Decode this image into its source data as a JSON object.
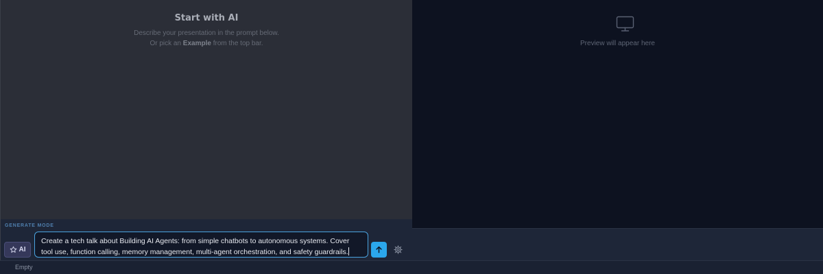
{
  "editor": {
    "empty_title": "Start with AI",
    "desc_line1": "Describe your presentation in the prompt below.",
    "desc_line2_prefix": "Or pick an ",
    "desc_line2_bold": "Example",
    "desc_line2_suffix": " from the top bar."
  },
  "preview": {
    "placeholder": "Preview will appear here",
    "icon": "monitor-icon"
  },
  "prompt": {
    "mode_label": "GENERATE MODE",
    "ai_button_label": "AI",
    "ai_icon": "star-icon",
    "value": "Create a tech talk about Building AI Agents: from simple chatbots to autonomous systems. Cover tool use, function calling, memory management, multi-agent orchestration, and safety guardrails.",
    "send_icon": "arrow-up-icon",
    "settings_icon": "gear-icon",
    "accent_color": "#2ba7ec"
  },
  "status": {
    "text": "Empty"
  }
}
